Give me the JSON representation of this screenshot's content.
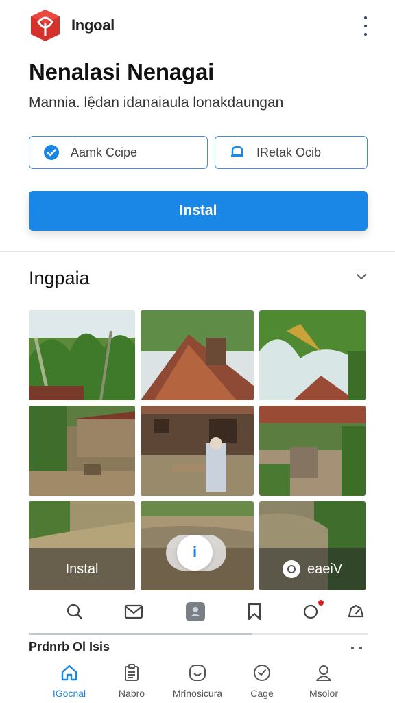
{
  "app": {
    "name": "Ingoal"
  },
  "header": {
    "title": "Nenalasi Nenagai",
    "subtitle": "Mannia. lệdan idanaiaula lonakdaungan"
  },
  "options": {
    "left_label": "Aamk Ccipe",
    "right_label": "IRetak Ocib"
  },
  "install_button": "Instal",
  "section": {
    "title": "Ingpaia"
  },
  "gallery": {
    "overlay_left": "Instal",
    "overlay_right": "eaeiV",
    "info_glyph": "i"
  },
  "progress": 0.66,
  "bottom": {
    "heading": "Prdnrb Ol Isis"
  },
  "tabs": [
    {
      "label": "IGocnal",
      "icon": "home-icon",
      "active": true
    },
    {
      "label": "Nabro",
      "icon": "clipboard-icon",
      "active": false
    },
    {
      "label": "Mrinosicura",
      "icon": "smiley-icon",
      "active": false
    },
    {
      "label": "Cage",
      "icon": "check-circle-icon",
      "active": false
    },
    {
      "label": "Msolor",
      "icon": "user-icon",
      "active": false
    }
  ],
  "colors": {
    "accent": "#1a87e6",
    "logo": "#d6322c",
    "badge": "#e02020"
  }
}
